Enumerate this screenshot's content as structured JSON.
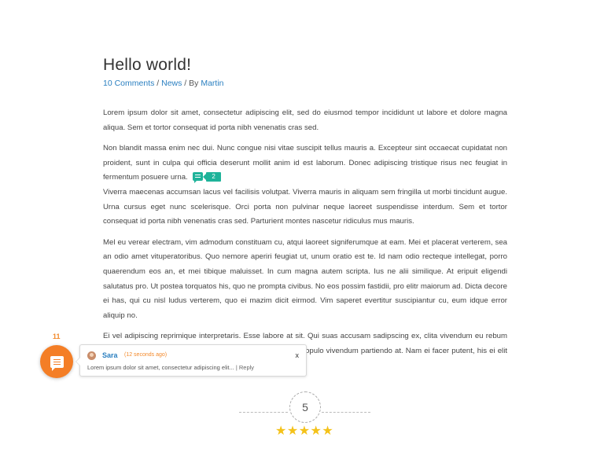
{
  "post": {
    "title": "Hello world!",
    "comments_link": "10 Comments",
    "sep1": " / ",
    "category": "News",
    "sep2": " / By ",
    "author": "Martin",
    "paragraphs": [
      "Lorem ipsum dolor sit amet, consectetur adipiscing elit, sed do eiusmod tempor incididunt ut labore et dolore magna aliqua.  Sem et tortor consequat id porta nibh venenatis cras sed.",
      "Non blandit massa enim nec dui. Nunc congue nisi vitae suscipit tellus mauris a. Excepteur sint occaecat cupidatat non proident, sunt in culpa qui officia deserunt mollit anim id est laborum. Donec adipiscing tristique risus nec feugiat in fermentum posuere urna.",
      "Viverra maecenas accumsan lacus vel facilisis volutpat. Viverra mauris in aliquam sem fringilla ut morbi tincidunt augue. Urna cursus eget nunc scelerisque. Orci porta non pulvinar neque laoreet suspendisse interdum. Sem et tortor consequat id porta nibh venenatis cras sed. Parturient montes nascetur ridiculus mus mauris.",
      "Mel eu verear electram, vim admodum constituam cu, atqui laoreet signiferumque at eam. Mei et placerat verterem, sea an odio amet vituperatoribus. Quo nemore aperiri feugiat ut, unum oratio est te. Id nam odio recteque intellegat, porro quaerendum eos an, et mei tibique maluisset. In cum magna autem scripta. Ius ne alii similique. At eripuit eligendi salutatus pro. Ut postea torquatos his, quo ne prompta civibus. No eos possim fastidii, pro elitr maiorum ad. Dicta decore ei has, qui cu nisl ludus verterem, quo ei mazim dicit eirmod. Vim saperet evertitur suscipiantur cu, eum idque error aliquip no.",
      "Ei vel adipiscing reprimique interpretaris. Esse labore at sit. Qui suas accusam sadipscing ex, clita vivendum eu rebum voluptua ubique sadipscing, ne idque nostro copiosae vix, populo vivendum partiendo at. Nam ei facer putent, his ei elit error omnesque, an vitae timeam omnesque nam."
    ],
    "inline_comment_count": "2"
  },
  "floating_widget": {
    "count": "11"
  },
  "comment_popup": {
    "author": "Sara",
    "time": "(12 seconds ago)",
    "close": "x",
    "snippet": "Lorem ipsum dolor sit amet, consectetur adipiscing elit...",
    "reply": " | Reply"
  },
  "rating": {
    "value": "5",
    "stars": 5
  },
  "colors": {
    "accent_teal": "#1fb39a",
    "accent_orange": "#f47e26",
    "link_blue": "#2a7fc0",
    "star_yellow": "#f4c21a"
  },
  "icons": {
    "fab": "comment-bubble-icon",
    "inline": "comment-bubble-icon",
    "star": "star-icon"
  }
}
